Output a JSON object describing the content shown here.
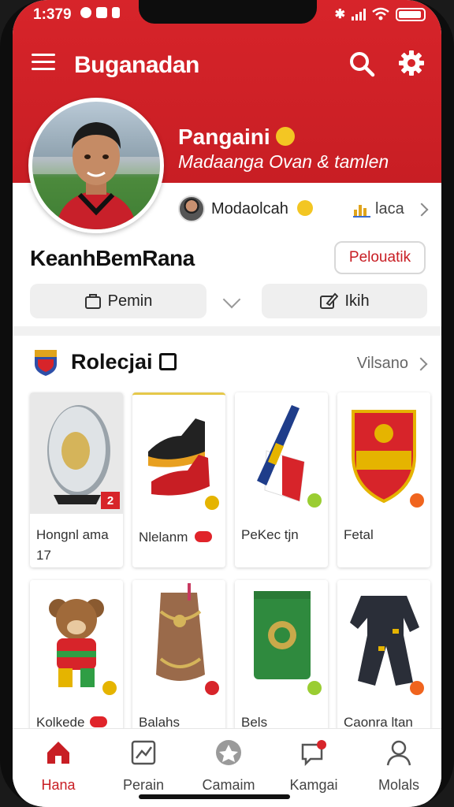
{
  "status": {
    "time": "1:379"
  },
  "header": {
    "title": "Buganadan"
  },
  "profile": {
    "name": "Pangaini",
    "subtitle": "Madaanga Ovan & tamlen",
    "follower_name": "Modaolcah",
    "follower_meta": "laca",
    "username": "KeanhBemRana",
    "follow_button": "Pelouatik"
  },
  "actions": [
    {
      "label": "Pemin"
    },
    {
      "label": "Ikih"
    }
  ],
  "collection": {
    "title": "Rolecjai",
    "see_all": "Vilsano",
    "items": [
      {
        "label": "Hongnl ama 17",
        "badge": "2"
      },
      {
        "label": "Nlelanm"
      },
      {
        "label": "PeKec tjn"
      },
      {
        "label": "Fetal"
      },
      {
        "label": "Kolkede"
      },
      {
        "label": "Balahs"
      },
      {
        "label": "Bels"
      },
      {
        "label": "Caonra ltan"
      }
    ]
  },
  "nav": [
    {
      "label": "Hana",
      "icon": "home-icon",
      "active": true
    },
    {
      "label": "Perain",
      "icon": "chart-icon"
    },
    {
      "label": "Camaim",
      "icon": "community-icon"
    },
    {
      "label": "Kamgai",
      "icon": "chat-icon"
    },
    {
      "label": "Molals",
      "icon": "profile-icon"
    }
  ],
  "colors": {
    "brand_red": "#d7242a",
    "muted_bg": "#efefef"
  }
}
